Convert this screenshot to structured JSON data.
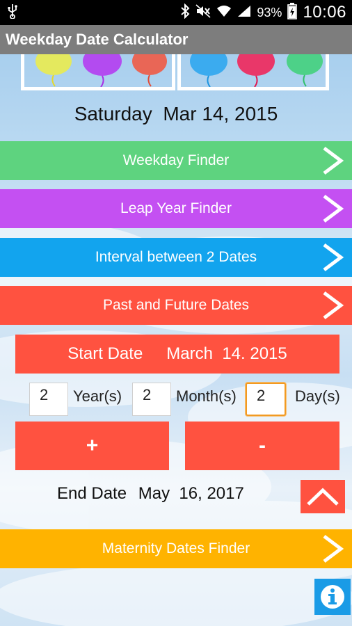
{
  "status_bar": {
    "battery_percent": "93%",
    "time": "10:06",
    "icons": [
      "usb-icon",
      "bluetooth-icon",
      "mute-icon",
      "wifi-icon",
      "signal-icon",
      "battery-charging-icon"
    ]
  },
  "app": {
    "title": "Weekday Date Calculator"
  },
  "current_date": "Saturday  Mar 14, 2015",
  "menu": [
    {
      "label": "Weekday Finder",
      "color": "#5ed37f"
    },
    {
      "label": "Leap Year Finder",
      "color": "#c450f2"
    },
    {
      "label": "Interval between 2 Dates",
      "color": "#12a4ee"
    },
    {
      "label": "Past and Future Dates",
      "color": "#ff5240"
    }
  ],
  "calculator": {
    "start_label": "Start Date",
    "start_value": "March  14. 2015",
    "years_value": "2",
    "years_label": "Year(s)",
    "months_value": "2",
    "months_label": "Month(s)",
    "days_value": "2",
    "days_label": "Day(s)",
    "add_label": "+",
    "subtract_label": "-",
    "end_label": "End Date",
    "end_value": "May  16, 2017"
  },
  "maternity": {
    "label": "Maternity Dates Finder",
    "color": "#ffb300"
  },
  "colors": {
    "accent_red": "#ff5240",
    "info_blue": "#1a9be6",
    "focus_orange": "#f29a22"
  }
}
